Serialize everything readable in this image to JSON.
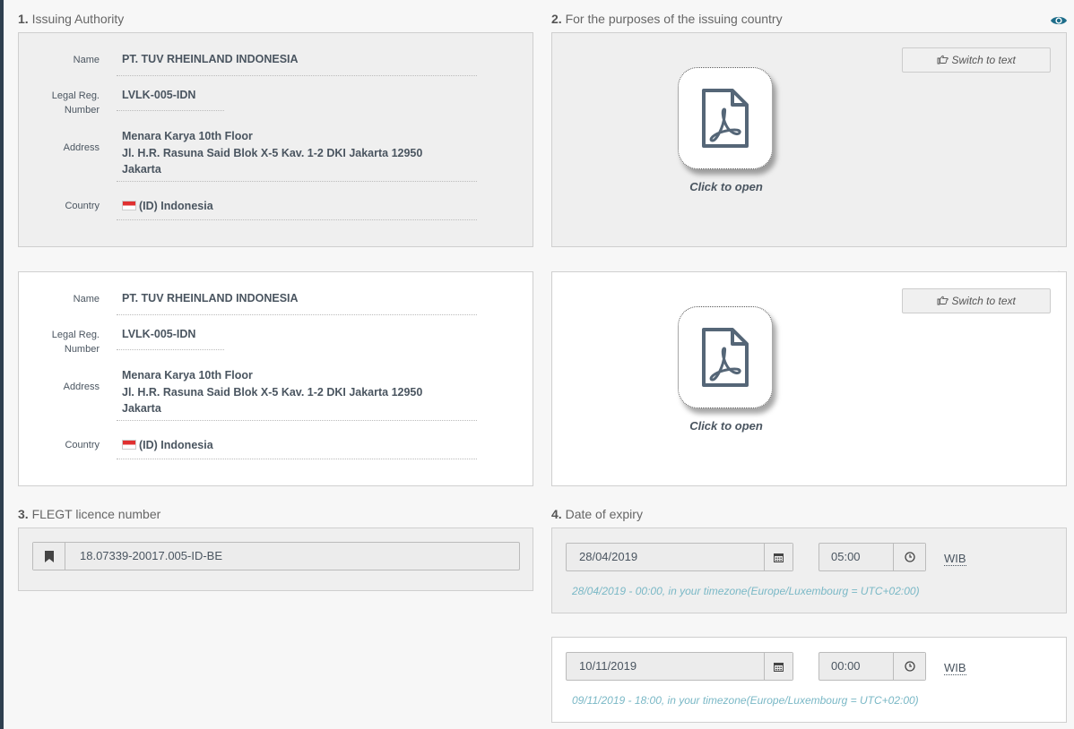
{
  "section1": {
    "number": "1.",
    "title": "Issuing Authority",
    "labels": {
      "name": "Name",
      "legal_reg_1": "Legal Reg.",
      "legal_reg_2": "Number",
      "address": "Address",
      "country": "Country"
    },
    "entries": [
      {
        "name": "PT. TUV RHEINLAND INDONESIA",
        "legal_reg": "LVLK-005-IDN",
        "address_line1": "Menara Karya 10th Floor",
        "address_line2": "Jl. H.R. Rasuna Said Blok X-5 Kav. 1-2 DKI Jakarta 12950",
        "address_line3": "Jakarta",
        "country": "(ID) Indonesia"
      },
      {
        "name": "PT. TUV RHEINLAND INDONESIA",
        "legal_reg": "LVLK-005-IDN",
        "address_line1": "Menara Karya 10th Floor",
        "address_line2": "Jl. H.R. Rasuna Said Blok X-5 Kav. 1-2 DKI Jakarta 12950",
        "address_line3": "Jakarta",
        "country": "(ID) Indonesia"
      }
    ]
  },
  "section2": {
    "number": "2.",
    "title": "For the purposes of the issuing country",
    "switch_label": "Switch to text",
    "click_label": "Click to open"
  },
  "section3": {
    "number": "3.",
    "title": "FLEGT licence number",
    "licence_number": "18.07339-20017.005-ID-BE"
  },
  "section4": {
    "number": "4.",
    "title": "Date of expiry",
    "entries": [
      {
        "date": "28/04/2019",
        "time": "05:00",
        "timezone": "WIB",
        "note": "28/04/2019 - 00:00, in your timezone(Europe/Luxembourg = UTC+02:00)"
      },
      {
        "date": "10/11/2019",
        "time": "00:00",
        "timezone": "WIB",
        "note": "09/11/2019 - 18:00, in your timezone(Europe/Luxembourg = UTC+02:00)"
      }
    ]
  },
  "colors": {
    "accent_eye_active": "#1e6d8a",
    "eye_inactive": "#888888",
    "tz_note": "#7ab8c6",
    "sidebar": "#2e3f4f"
  },
  "icons": {
    "visibility": "eye-icon",
    "document": "pdf-file-icon",
    "switch": "hand-point-right-icon",
    "licence": "bookmark-icon",
    "date": "calendar-icon",
    "time": "clock-icon"
  }
}
